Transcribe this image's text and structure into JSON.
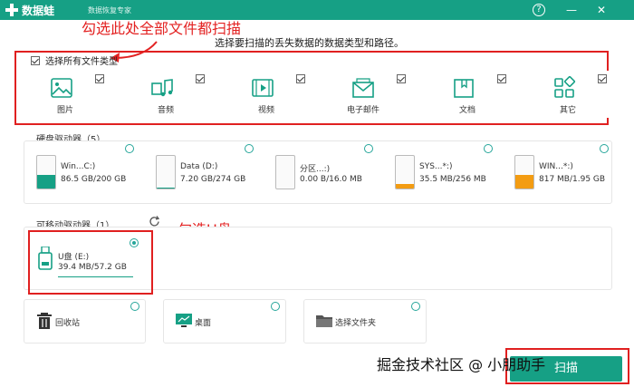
{
  "titlebar": {
    "app_name": "数据蛙",
    "app_sub": "数据恢复专家",
    "help": "?",
    "minimize": "—",
    "close": "✕"
  },
  "subtitle": "选择要扫描的丢失数据的数据类型和路径。",
  "annotations": {
    "scan_all": "勾选此处全部文件都扫描",
    "select_u": "勾选U盘"
  },
  "file_types": {
    "select_all_label": "选择所有文件类型",
    "items": [
      {
        "label": "图片",
        "icon": "image-icon"
      },
      {
        "label": "音频",
        "icon": "music-icon"
      },
      {
        "label": "视频",
        "icon": "video-icon"
      },
      {
        "label": "电子邮件",
        "icon": "mail-icon"
      },
      {
        "label": "文档",
        "icon": "document-icon"
      },
      {
        "label": "其它",
        "icon": "other-icon"
      }
    ]
  },
  "hard_drives": {
    "label": "硬盘驱动器（5）",
    "drives": [
      {
        "name": "Win...C:)",
        "size": "86.5 GB/200 GB",
        "fill_fraction": 0.43,
        "color": "#16a085"
      },
      {
        "name": "Data (D:)",
        "size": "7.20 GB/274 GB",
        "fill_fraction": 0.03,
        "color": "#16a085"
      },
      {
        "name": "分区...:)",
        "size": "0.00  B/16.0 MB",
        "fill_fraction": 0.0,
        "color": "#16a085"
      },
      {
        "name": "SYS...*:)",
        "size": "35.5 MB/256 MB",
        "fill_fraction": 0.14,
        "color": "#f39c12"
      },
      {
        "name": "WIN...*:)",
        "size": "817 MB/1.95 GB",
        "fill_fraction": 0.42,
        "color": "#f39c12"
      }
    ]
  },
  "removable": {
    "label": "可移动驱动器（1）",
    "drive": {
      "name": "U盘 (E:)",
      "size": "39.4 MB/57.2 GB",
      "selected": true
    }
  },
  "locations": [
    {
      "label": "回收站",
      "icon": "trash-icon"
    },
    {
      "label": "桌面",
      "icon": "desktop-icon"
    },
    {
      "label": "选择文件夹",
      "icon": "folder-icon"
    }
  ],
  "watermark": "掘金技术社区 @ 小朋助手",
  "scan_button": "扫描"
}
